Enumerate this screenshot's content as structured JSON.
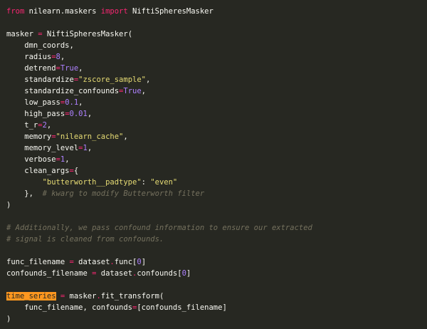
{
  "code_lines": [
    [
      {
        "t": "from",
        "c": "kw"
      },
      {
        "t": " nilearn.maskers ",
        "c": "txt"
      },
      {
        "t": "import",
        "c": "kw"
      },
      {
        "t": " NiftiSpheresMasker",
        "c": "txt"
      }
    ],
    [],
    [
      {
        "t": "masker ",
        "c": "txt"
      },
      {
        "t": "=",
        "c": "op"
      },
      {
        "t": " NiftiSpheresMasker(",
        "c": "txt"
      }
    ],
    [
      {
        "t": "    dmn_coords,",
        "c": "txt"
      }
    ],
    [
      {
        "t": "    radius",
        "c": "txt"
      },
      {
        "t": "=",
        "c": "op"
      },
      {
        "t": "8",
        "c": "num"
      },
      {
        "t": ",",
        "c": "txt"
      }
    ],
    [
      {
        "t": "    detrend",
        "c": "txt"
      },
      {
        "t": "=",
        "c": "op"
      },
      {
        "t": "True",
        "c": "num"
      },
      {
        "t": ",",
        "c": "txt"
      }
    ],
    [
      {
        "t": "    standardize",
        "c": "txt"
      },
      {
        "t": "=",
        "c": "op"
      },
      {
        "t": "\"zscore_sample\"",
        "c": "str"
      },
      {
        "t": ",",
        "c": "txt"
      }
    ],
    [
      {
        "t": "    standardize_confounds",
        "c": "txt"
      },
      {
        "t": "=",
        "c": "op"
      },
      {
        "t": "True",
        "c": "num"
      },
      {
        "t": ",",
        "c": "txt"
      }
    ],
    [
      {
        "t": "    low_pass",
        "c": "txt"
      },
      {
        "t": "=",
        "c": "op"
      },
      {
        "t": "0.1",
        "c": "num"
      },
      {
        "t": ",",
        "c": "txt"
      }
    ],
    [
      {
        "t": "    high_pass",
        "c": "txt"
      },
      {
        "t": "=",
        "c": "op"
      },
      {
        "t": "0.01",
        "c": "num"
      },
      {
        "t": ",",
        "c": "txt"
      }
    ],
    [
      {
        "t": "    t_r",
        "c": "txt"
      },
      {
        "t": "=",
        "c": "op"
      },
      {
        "t": "2",
        "c": "num"
      },
      {
        "t": ",",
        "c": "txt"
      }
    ],
    [
      {
        "t": "    memory",
        "c": "txt"
      },
      {
        "t": "=",
        "c": "op"
      },
      {
        "t": "\"nilearn_cache\"",
        "c": "str"
      },
      {
        "t": ",",
        "c": "txt"
      }
    ],
    [
      {
        "t": "    memory_level",
        "c": "txt"
      },
      {
        "t": "=",
        "c": "op"
      },
      {
        "t": "1",
        "c": "num"
      },
      {
        "t": ",",
        "c": "txt"
      }
    ],
    [
      {
        "t": "    verbose",
        "c": "txt"
      },
      {
        "t": "=",
        "c": "op"
      },
      {
        "t": "1",
        "c": "num"
      },
      {
        "t": ",",
        "c": "txt"
      }
    ],
    [
      {
        "t": "    clean_args",
        "c": "txt"
      },
      {
        "t": "=",
        "c": "op"
      },
      {
        "t": "{",
        "c": "txt"
      }
    ],
    [
      {
        "t": "        ",
        "c": "txt"
      },
      {
        "t": "\"butterworth__padtype\"",
        "c": "str"
      },
      {
        "t": ": ",
        "c": "txt"
      },
      {
        "t": "\"even\"",
        "c": "str"
      }
    ],
    [
      {
        "t": "    },  ",
        "c": "txt"
      },
      {
        "t": "# kwarg to modify Butterworth filter",
        "c": "cmt"
      }
    ],
    [
      {
        "t": ")",
        "c": "txt"
      }
    ],
    [],
    [
      {
        "t": "# Additionally, we pass confound information to ensure our extracted",
        "c": "cmt"
      }
    ],
    [
      {
        "t": "# signal is cleaned from confounds.",
        "c": "cmt"
      }
    ],
    [],
    [
      {
        "t": "func_filename ",
        "c": "txt"
      },
      {
        "t": "=",
        "c": "op"
      },
      {
        "t": " dataset",
        "c": "txt"
      },
      {
        "t": ".",
        "c": "op"
      },
      {
        "t": "func[",
        "c": "txt"
      },
      {
        "t": "0",
        "c": "num"
      },
      {
        "t": "]",
        "c": "txt"
      }
    ],
    [
      {
        "t": "confounds_filename ",
        "c": "txt"
      },
      {
        "t": "=",
        "c": "op"
      },
      {
        "t": " dataset",
        "c": "txt"
      },
      {
        "t": ".",
        "c": "op"
      },
      {
        "t": "confounds[",
        "c": "txt"
      },
      {
        "t": "0",
        "c": "num"
      },
      {
        "t": "]",
        "c": "txt"
      }
    ],
    [],
    [
      {
        "t": "time_series",
        "c": "hl"
      },
      {
        "t": " ",
        "c": "txt"
      },
      {
        "t": "=",
        "c": "op"
      },
      {
        "t": " masker",
        "c": "txt"
      },
      {
        "t": ".",
        "c": "op"
      },
      {
        "t": "fit_transform(",
        "c": "txt"
      }
    ],
    [
      {
        "t": "    func_filename, confounds",
        "c": "txt"
      },
      {
        "t": "=",
        "c": "op"
      },
      {
        "t": "[confounds_filename]",
        "c": "txt"
      }
    ],
    [
      {
        "t": ")",
        "c": "txt"
      }
    ]
  ],
  "colors": {
    "background": "#272822",
    "keyword": "#f92672",
    "number": "#ae81ff",
    "string": "#e6db74",
    "comment": "#75715e",
    "text": "#f8f8f2",
    "highlight": "#fd971f"
  }
}
